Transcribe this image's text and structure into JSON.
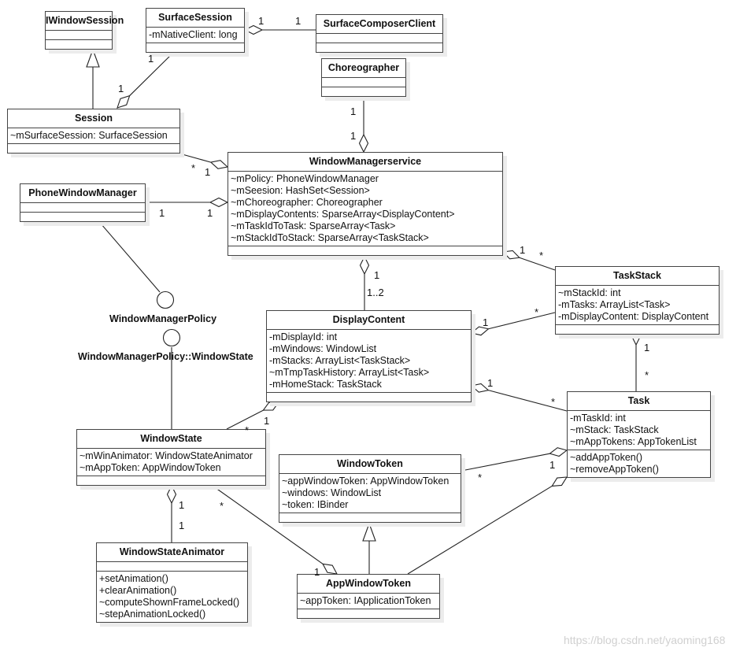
{
  "classes": {
    "iwindowsession": {
      "name": "IWindowSession",
      "attributes": [],
      "operations": []
    },
    "surfacesession": {
      "name": "SurfaceSession",
      "attributes": [
        "-mNativeClient: long"
      ],
      "operations": []
    },
    "surfacecomposerclient": {
      "name": "SurfaceComposerClient",
      "attributes": [],
      "operations": []
    },
    "choreographer": {
      "name": "Choreographer",
      "attributes": [],
      "operations": []
    },
    "session": {
      "name": "Session",
      "attributes": [
        "~mSurfaceSession: SurfaceSession"
      ],
      "operations": []
    },
    "wms": {
      "name": "WindowManagerservice",
      "attributes": [
        "~mPolicy: PhoneWindowManager",
        "~mSeesion: HashSet<Session>",
        "~mChoreographer: Choreographer",
        "~mDisplayContents: SparseArray<DisplayContent>",
        "~mTaskIdToTask: SparseArray<Task>",
        "~mStackIdToStack: SparseArray<TaskStack>"
      ],
      "operations": []
    },
    "phonewindowmanager": {
      "name": "PhoneWindowManager",
      "attributes": [],
      "operations": []
    },
    "taskstack": {
      "name": "TaskStack",
      "attributes": [
        "~mStackId: int",
        "-mTasks: ArrayList<Task>",
        "-mDisplayContent: DisplayContent"
      ],
      "operations": []
    },
    "displaycontent": {
      "name": "DisplayContent",
      "attributes": [
        "-mDisplayId: int",
        "-mWindows: WindowList",
        "-mStacks: ArrayList<TaskStack>",
        "~mTmpTaskHistory: ArrayList<Task>",
        "-mHomeStack: TaskStack"
      ],
      "operations": []
    },
    "task": {
      "name": "Task",
      "attributes": [
        "-mTaskId: int",
        "~mStack: TaskStack",
        "~mAppTokens: AppTokenList"
      ],
      "operations": [
        "~addAppToken()",
        "~removeAppToken()"
      ]
    },
    "windowstate": {
      "name": "WindowState",
      "attributes": [
        "~mWinAnimator: WindowStateAnimator",
        "~mAppToken: AppWindowToken"
      ],
      "operations": []
    },
    "windowtoken": {
      "name": "WindowToken",
      "attributes": [
        "~appWindowToken: AppWindowToken",
        "~windows: WindowList",
        "~token: IBinder"
      ],
      "operations": []
    },
    "windowstateanimator": {
      "name": "WindowStateAnimator",
      "attributes": [],
      "operations": [
        "+setAnimation()",
        "+clearAnimation()",
        "~computeShownFrameLocked()",
        "~stepAnimationLocked()"
      ]
    },
    "appwindowtoken": {
      "name": "AppWindowToken",
      "attributes": [
        "~appToken: IApplicationToken"
      ],
      "operations": []
    }
  },
  "interfaces": {
    "policy": "WindowManagerPolicy",
    "windowstate": "WindowManagerPolicy::WindowState"
  },
  "multiplicities": {
    "ss_scc_a": "1",
    "ss_scc_b": "1",
    "ss_session_a": "1",
    "ss_session_b": "1",
    "ch_wms_a": "1",
    "ch_wms_b": "1",
    "session_wms_a": "*",
    "session_wms_b": "1",
    "pwm_wms_a": "1",
    "pwm_wms_b": "1",
    "wms_dc_a": "1",
    "wms_dc_b": "1..2",
    "wms_ts_a": "1",
    "wms_ts_b": "*",
    "dc_ts_a": "1",
    "dc_ts_b": "*",
    "ts_task_a": "1",
    "ts_task_b": "*",
    "dc_task_a": "1",
    "dc_task_b": "*",
    "dc_ws_a": "1",
    "dc_ws_b": "*",
    "ws_wsa_a": "1",
    "ws_wsa_b": "1",
    "ws_awt_a": "*",
    "ws_awt_b": "1",
    "wt_task_a": "*",
    "wt_task_b": "1"
  },
  "watermark": "https://blog.csdn.net/yaoming168"
}
